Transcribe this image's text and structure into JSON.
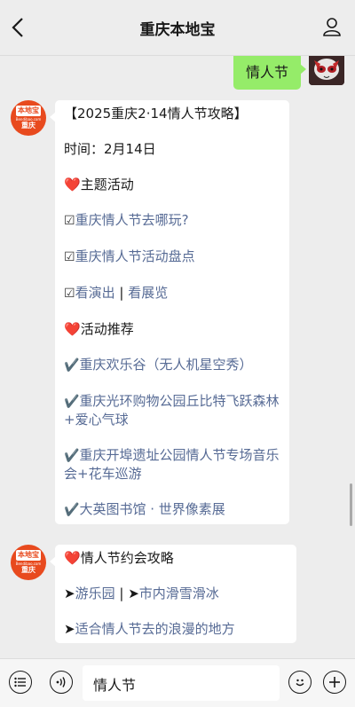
{
  "header": {
    "title": "重庆本地宝",
    "back_icon": "back-chevron-icon",
    "profile_icon": "person-icon"
  },
  "outgoing": {
    "text": "情人节"
  },
  "logo": {
    "top": "本地宝",
    "mid": "Bendibao.com",
    "bottom": "重庆"
  },
  "message1": {
    "heading": "【2025重庆2·14情人节攻略】",
    "time": "时间：2月14日",
    "section1": {
      "heart": "❤️",
      "title": "主题活动"
    },
    "links1": [
      {
        "prefix": "☑",
        "text": "重庆情人节去哪玩?"
      },
      {
        "prefix": "☑",
        "text": "重庆情人节活动盘点"
      }
    ],
    "show_link": {
      "prefix": "☑",
      "text": "看演出"
    },
    "separator": "|",
    "exhibit_link": {
      "text": "看展览"
    },
    "section2": {
      "heart": "❤️",
      "title": "活动推荐"
    },
    "links2": [
      {
        "prefix": "✔️",
        "text": "重庆欢乐谷（无人机星空秀）"
      },
      {
        "prefix": "✔️",
        "text": "重庆光环购物公园丘比特飞跃森林+爱心气球"
      },
      {
        "prefix": "✔️",
        "text": "重庆开埠遗址公园情人节专场音乐会+花车巡游"
      },
      {
        "prefix": "✔️",
        "text": "大英图书馆 · 世界像素展"
      }
    ]
  },
  "message2": {
    "section": {
      "heart": "❤️",
      "title": "情人节约会攻略"
    },
    "park": {
      "prefix": "➤",
      "text": "游乐园"
    },
    "separator": "|",
    "ski": {
      "prefix": "➤",
      "text": "市内滑雪滑冰"
    },
    "romantic": {
      "prefix": "➤",
      "text": "适合情人节去的浪漫的地方"
    }
  },
  "input_bar": {
    "menu_icon": "list-menu-icon",
    "voice_icon": "voice-icon",
    "input_value": "情人节",
    "emoji_icon": "emoji-icon",
    "plus_icon": "plus-icon"
  }
}
